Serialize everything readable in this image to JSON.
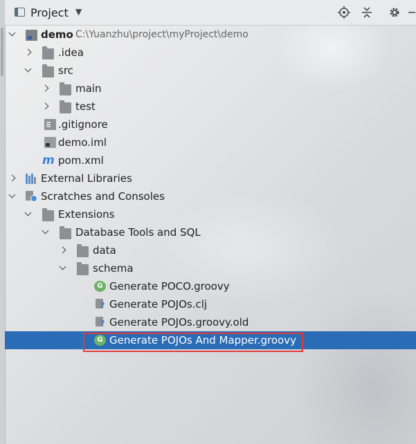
{
  "header": {
    "title": "Project",
    "icons": [
      "window-icon",
      "chevron-down-icon",
      "locate-icon",
      "collapse-all-icon",
      "gear-icon"
    ]
  },
  "tree": {
    "root": {
      "label": "demo",
      "path": "C:\\Yuanzhu\\project\\myProject\\demo"
    },
    "idea": "idea",
    "src": "src",
    "main": "main",
    "test": "test",
    "gitignore": ".gitignore",
    "demo_iml": "demo.iml",
    "pom": "pom.xml",
    "external_libraries": "External Libraries",
    "scratches": "Scratches and Consoles",
    "extensions": "Extensions",
    "db_tools": "Database Tools and SQL",
    "data": "data",
    "schema": "schema",
    "files": [
      {
        "label": "Generate POCO.groovy",
        "icon": "groovy-icon"
      },
      {
        "label": "Generate POJOs.clj",
        "icon": "unknown-file-icon"
      },
      {
        "label": "Generate POJOs.groovy.old",
        "icon": "unknown-file-icon"
      },
      {
        "label": "Generate POJOs And Mapper.groovy",
        "icon": "groovy-icon",
        "selected": true
      }
    ]
  },
  "colors": {
    "selection": "#2b6cb6",
    "highlight_border": "#e23a3a",
    "groovy": "#6fb36a"
  }
}
